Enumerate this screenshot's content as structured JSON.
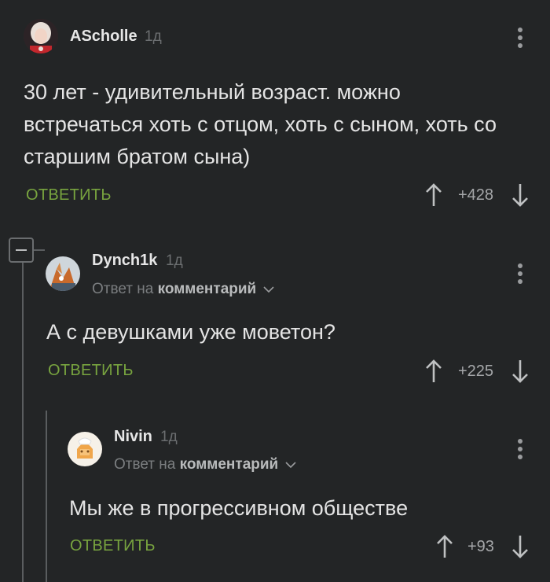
{
  "comments": [
    {
      "username": "AScholle",
      "time": "1д",
      "text": "30 лет - удивительный возраст. можно встречаться хоть с отцом, хоть с сыном, хоть со старшим братом сына)",
      "reply_label": "ОТВЕТИТЬ",
      "rating": "+428"
    },
    {
      "username": "Dynch1k",
      "time": "1д",
      "reply_to_prefix": "Ответ на",
      "reply_to_target": "комментарий",
      "text": "А с девушками уже моветон?",
      "reply_label": "ОТВЕТИТЬ",
      "rating": "+225"
    },
    {
      "username": "Nivin",
      "time": "1д",
      "reply_to_prefix": "Ответ на",
      "reply_to_target": "комментарий",
      "text": "Мы же в прогрессивном обществе",
      "reply_label": "ОТВЕТИТЬ",
      "rating": "+93"
    }
  ],
  "colors": {
    "background": "#232526",
    "reply_green": "#78a43f",
    "thread_line": "#5a5d5f"
  },
  "icons": [
    "avatar",
    "more-icon",
    "upvote-icon",
    "downvote-icon",
    "collapse-icon",
    "chevron-down-icon"
  ]
}
